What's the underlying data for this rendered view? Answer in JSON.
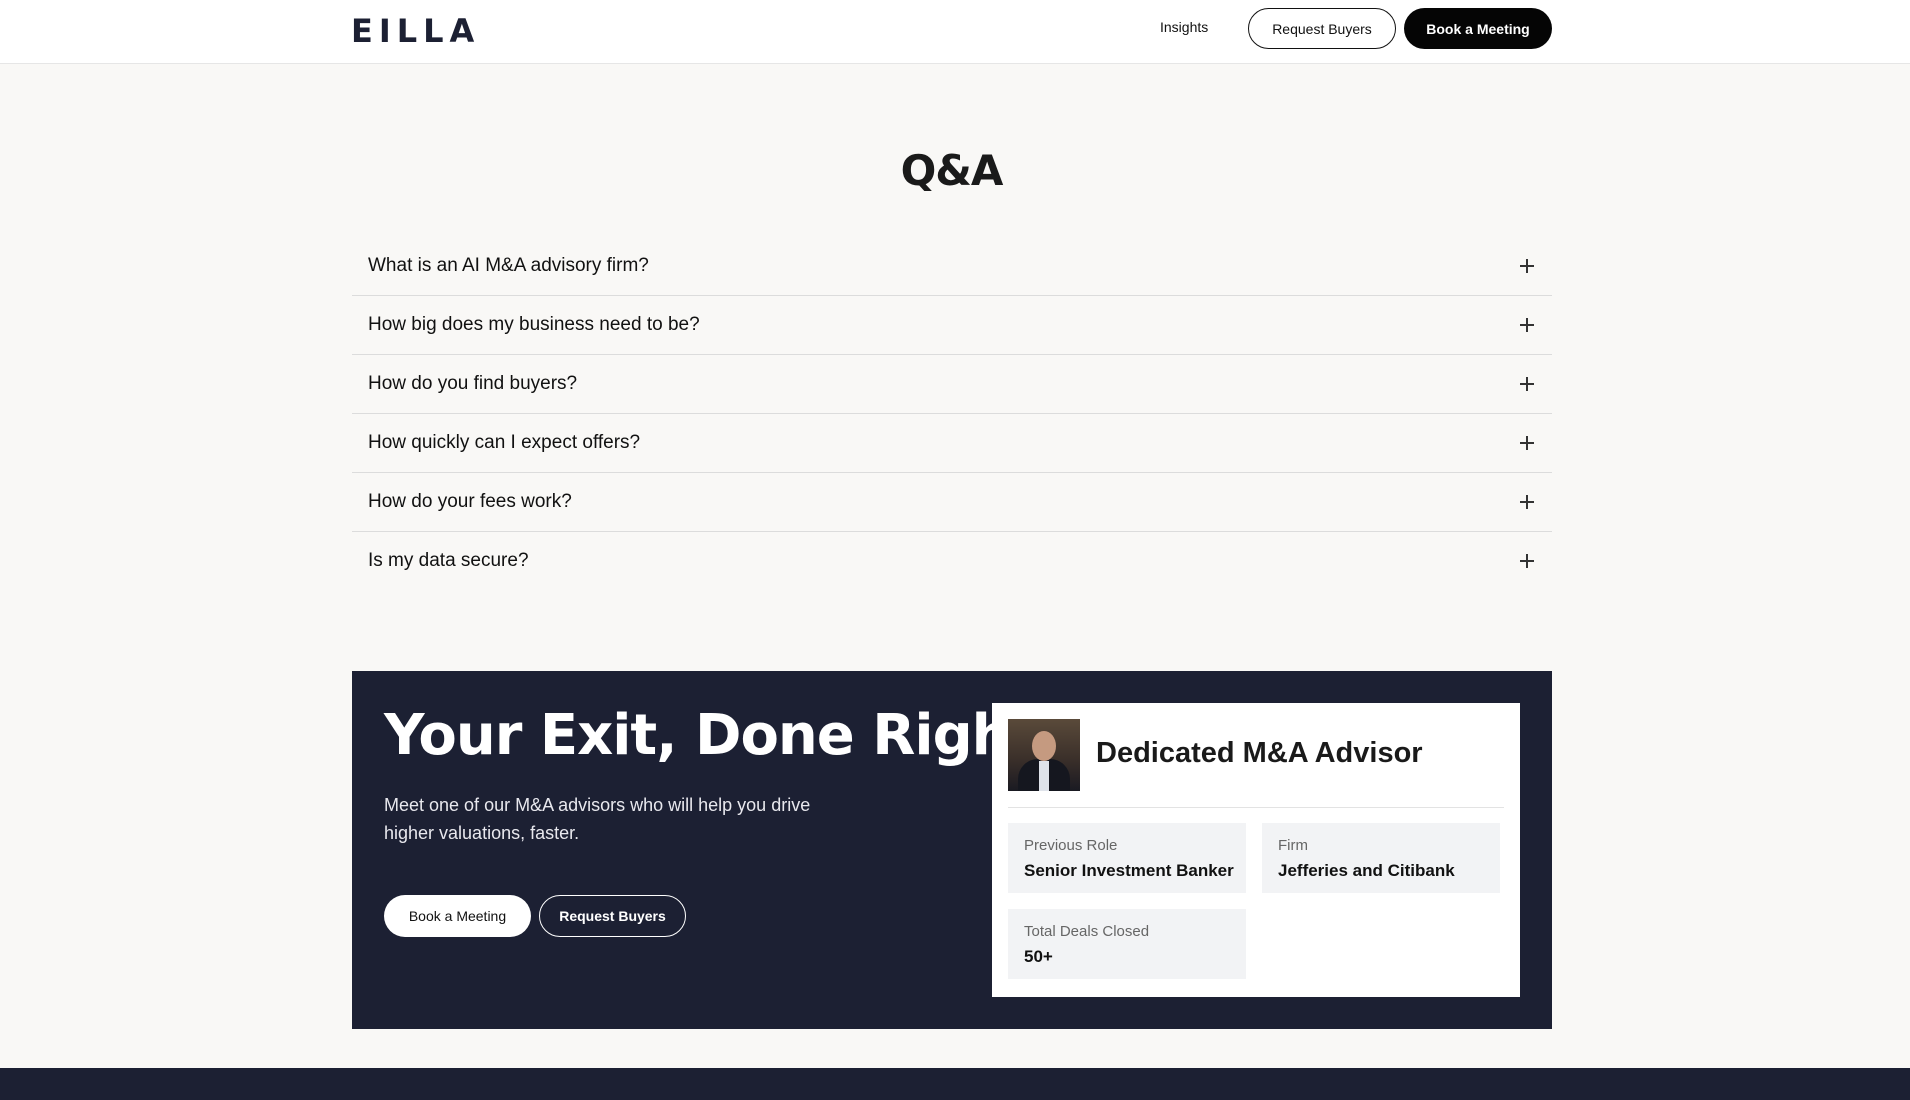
{
  "header": {
    "logo": "EILLA",
    "nav_insights": "Insights",
    "request_buyers": "Request Buyers",
    "book_meeting": "Book a Meeting"
  },
  "qa": {
    "title": "Q&A",
    "items": [
      {
        "question": "What is an AI M&A advisory firm?"
      },
      {
        "question": "How big does my business need to be?"
      },
      {
        "question": "How do you find buyers?"
      },
      {
        "question": "How quickly can I expect offers?"
      },
      {
        "question": "How do your fees work?"
      },
      {
        "question": "Is my data secure?"
      }
    ]
  },
  "cta": {
    "title": "Your Exit, Done Right.",
    "subtitle": "Meet one of our M&A advisors who will help you drive higher valuations, faster.",
    "book_meeting": "Book a Meeting",
    "request_buyers": "Request Buyers",
    "card": {
      "title": "Dedicated M&A Advisor",
      "stats": [
        {
          "label": "Previous Role",
          "value": "Senior Investment Banker"
        },
        {
          "label": "Firm",
          "value": "Jefferies and Citibank"
        },
        {
          "label": "Total Deals Closed",
          "value": "50+"
        }
      ]
    }
  },
  "colors": {
    "navy": "#1c2033",
    "page_bg": "#f9f8f6",
    "stat_bg": "#f2f3f5"
  },
  "icons": {
    "expand": "plus-icon"
  }
}
